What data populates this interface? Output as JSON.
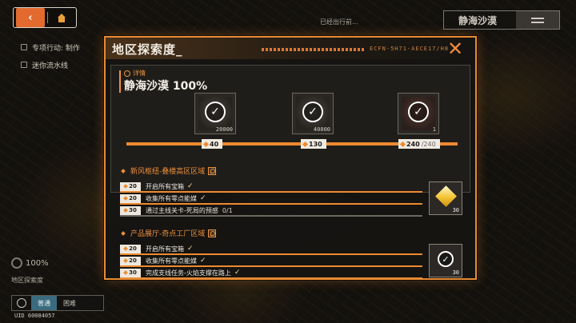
{
  "nav": {
    "back_icon": "chevron-left-icon",
    "home_icon": "home-icon"
  },
  "side_list": [
    {
      "label": "专项行动: 制作"
    },
    {
      "label": "迷你流水线"
    }
  ],
  "top_hint": "已经出行前...",
  "region_tag": {
    "label": "静海沙漠"
  },
  "bottom_left": {
    "percent": "100%",
    "label": "地区探索度",
    "tabs": [
      "普通",
      "困难"
    ],
    "uid": "UID 60084057"
  },
  "dialog": {
    "title": "地区探索度_",
    "code": "ECFN-5H71-AECE17/H8",
    "close_icon": "close-icon",
    "detail_tag": "详情",
    "region_name": "静海沙漠 100%",
    "accent_color": "#ee8a30",
    "rewards": [
      {
        "qty": "20000",
        "claimed": true,
        "icon": "chip-icon"
      },
      {
        "qty": "40000",
        "claimed": true,
        "icon": "chip-icon"
      },
      {
        "qty": "1",
        "claimed": true,
        "icon": "relic-icon"
      }
    ],
    "progress": {
      "current": 240,
      "max": 240,
      "fraction": 1.0,
      "milestones": [
        "40",
        "130",
        "240"
      ],
      "total_label": "/240"
    },
    "sections": [
      {
        "title": "新风枢纽-叠楼高区区域",
        "tasks": [
          {
            "points": "20",
            "label": "开启所有宝箱",
            "done": true,
            "progress": ""
          },
          {
            "points": "20",
            "label": "收集所有零点能媒",
            "done": true,
            "progress": ""
          },
          {
            "points": "30",
            "label": "通过主线关卡-死局的预感",
            "done": false,
            "progress": "0/1"
          }
        ],
        "reward": {
          "qty": "30",
          "icon": "gem-icon"
        }
      },
      {
        "title": "产品展厅-奇点工厂区域",
        "tasks": [
          {
            "points": "20",
            "label": "开启所有宝箱",
            "done": true,
            "progress": ""
          },
          {
            "points": "20",
            "label": "收集所有零点能媒",
            "done": true,
            "progress": ""
          },
          {
            "points": "30",
            "label": "完成支线任务-火焰支撑在路上",
            "done": true,
            "progress": ""
          }
        ],
        "reward": {
          "qty": "30",
          "icon": "gem-icon",
          "claimed": true
        }
      }
    ]
  }
}
